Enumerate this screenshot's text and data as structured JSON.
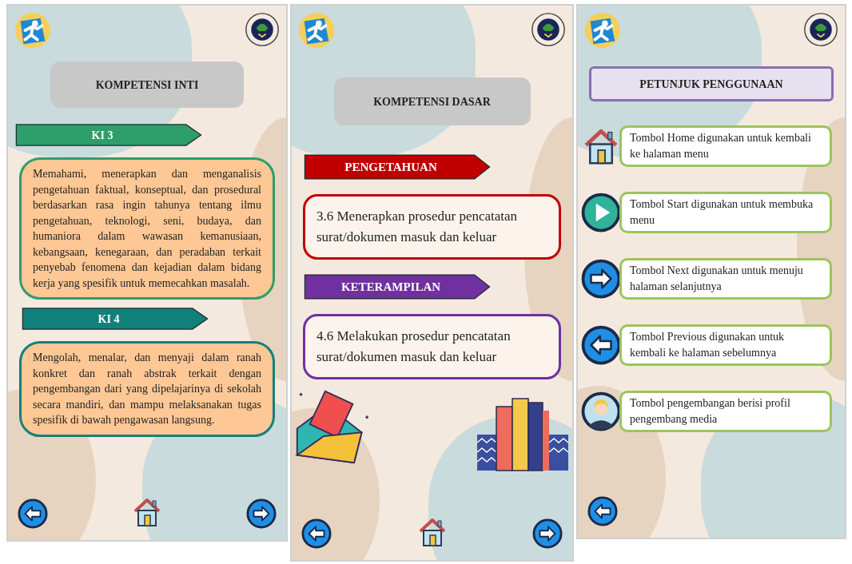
{
  "screens": [
    {
      "kind": "core",
      "title": "KOMPETENSI INTI",
      "sections": [
        {
          "label": "KI 3",
          "color": "#2e9e6b",
          "body": "Memahami, menerapkan dan menganalisis pengetahuan faktual, konseptual, dan prosedural berdasarkan rasa ingin tahunya tentang ilmu pengetahuan, teknologi, seni, budaya, dan humaniora dalam wawasan kemanusiaan, kebangsaan, kenegaraan, dan peradaban terkait penyebab fenomena dan kejadian dalam bidang kerja yang spesifik untuk memecahkan masalah."
        },
        {
          "label": "KI 4",
          "color": "#12807a",
          "body": "Mengolah, menalar, dan menyaji dalam ranah konkret dan ranah abstrak terkait dengan pengembangan dari yang dipelajarinya di sekolah secara mandiri, dan mampu melaksanakan tugas spesifik di bawah pengawasan langsung."
        }
      ],
      "nav": [
        {
          "kind": "prev"
        },
        {
          "kind": "home"
        },
        {
          "kind": "next"
        }
      ]
    },
    {
      "kind": "basic",
      "title": "KOMPETENSI DASAR",
      "sections": [
        {
          "label": "PENGETAHUAN",
          "color": "#c00000",
          "body": "3.6 Menerapkan prosedur pencatatan surat/dokumen masuk dan keluar"
        },
        {
          "label": "KETERAMPILAN",
          "color": "#7030a0",
          "body": "4.6 Melakukan prosedur pencatatan surat/dokumen masuk dan keluar"
        }
      ],
      "nav": [
        {
          "kind": "prev"
        },
        {
          "kind": "home"
        },
        {
          "kind": "next"
        }
      ]
    },
    {
      "kind": "guide",
      "title": "PETUNJUK  PENGGUNAAN",
      "items": [
        {
          "kind": "home",
          "text": "Tombol Home digunakan untuk kembali ke halaman menu"
        },
        {
          "kind": "play",
          "text": "Tombol Start digunakan untuk membuka menu"
        },
        {
          "kind": "next",
          "text": "Tombol Next digunakan untuk menuju halaman selanjutnya"
        },
        {
          "kind": "prev",
          "text": "Tombol Previous digunakan untuk kembali ke halaman sebelumnya"
        },
        {
          "kind": "person",
          "text": "Tombol pengembangan berisi profil pengembang media"
        }
      ],
      "nav": [
        {
          "kind": "prev"
        }
      ]
    }
  ]
}
